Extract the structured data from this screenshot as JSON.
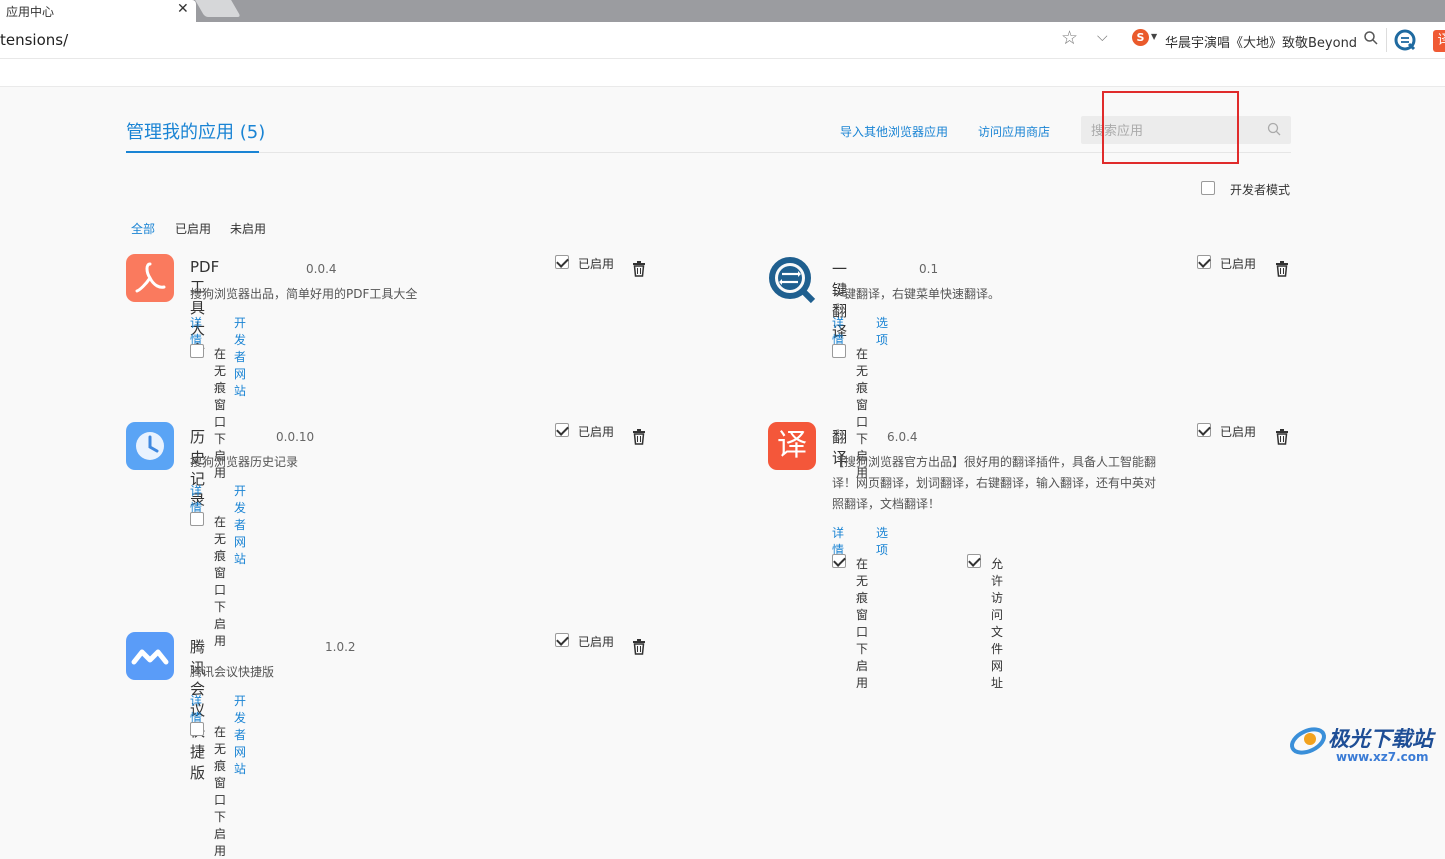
{
  "browser": {
    "tab_title": "应用中心",
    "tab_close": "✕",
    "url": "tensions/",
    "hot_search": "华晨宇演唱《大地》致敬Beyond",
    "translate_ext_label": "译"
  },
  "header": {
    "title": "管理我的应用 (5)",
    "import_link": "导入其他浏览器应用",
    "store_link": "访问应用商店",
    "search_placeholder": "搜索应用",
    "developer_mode": "开发者模式",
    "developer_mode_checked": false
  },
  "filters": {
    "all": "全部",
    "enabled": "已启用",
    "disabled": "未启用",
    "active": "all"
  },
  "extensions": [
    {
      "name": "PDF工具大全",
      "version": "0.0.4",
      "description": "搜狗浏览器出品，简单好用的PDF工具大全",
      "link1": "详情",
      "link2": "开发者网站",
      "enabled_label": "已启用",
      "enabled": true,
      "incognito_label": "在无痕窗口下启用",
      "incognito": false,
      "icon": "pdf-icon",
      "icon_color": "#fa7a5e"
    },
    {
      "name": "一键翻译",
      "version": "0.1",
      "description": "一键翻译，右键菜单快速翻译。",
      "link1": "详情",
      "link2": "选项",
      "enabled_label": "已启用",
      "enabled": true,
      "incognito_label": "在无痕窗口下启用",
      "incognito": false,
      "icon": "quick-translate-icon",
      "icon_color": "#1f5f8f"
    },
    {
      "name": "历史记录",
      "version": "0.0.10",
      "description": "搜狗浏览器历史记录",
      "link1": "详情",
      "link2": "开发者网站",
      "enabled_label": "已启用",
      "enabled": true,
      "incognito_label": "在无痕窗口下启用",
      "incognito": false,
      "icon": "clock-icon",
      "icon_color": "#5aa4f5"
    },
    {
      "name": "翻译",
      "version": "6.0.4",
      "description_lines": [
        "【搜狗浏览器官方出品】很好用的翻译插件，具备人工智能翻",
        "译！网页翻译，划词翻译，右键翻译，输入翻译，还有中英对",
        "照翻译，文档翻译！"
      ],
      "icon_char": "译",
      "link1": "详情",
      "link2": "选项",
      "enabled_label": "已启用",
      "enabled": true,
      "incognito_label": "在无痕窗口下启用",
      "incognito": true,
      "file_access_label": "允许访问文件网址",
      "file_access": true,
      "icon": "translate-icon",
      "icon_color": "#f4573a"
    },
    {
      "name": "腾讯会议快捷版",
      "version": "1.0.2",
      "description": "腾讯会议快捷版",
      "link1": "详情",
      "link2": "开发者网站",
      "enabled_label": "已启用",
      "enabled": true,
      "incognito_label": "在无痕窗口下启用",
      "incognito": false,
      "icon": "tencent-meeting-icon",
      "icon_color": "#5a9cf8"
    }
  ],
  "watermark": {
    "title": "极光下载站",
    "url": "www.xz7.com"
  },
  "colors": {
    "accent": "#1a84d4",
    "highlight_box": "#e02b2b"
  }
}
